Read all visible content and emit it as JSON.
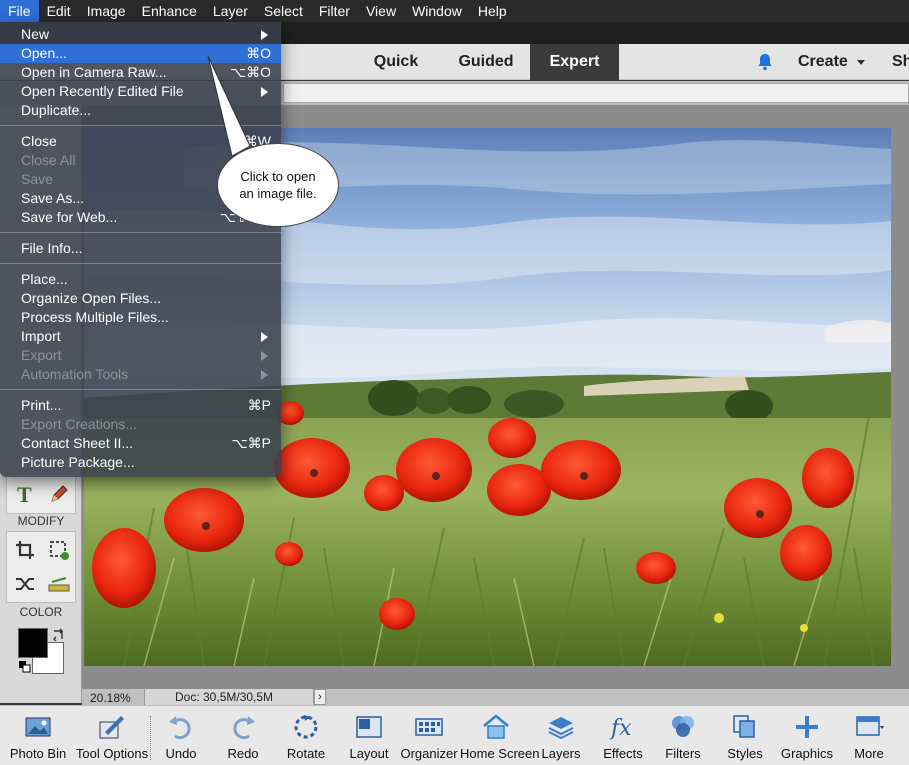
{
  "menubar": {
    "items": [
      "File",
      "Edit",
      "Image",
      "Enhance",
      "Layer",
      "Select",
      "Filter",
      "View",
      "Window",
      "Help"
    ],
    "active_index": 0
  },
  "modes": {
    "quick": "Quick",
    "guided": "Guided",
    "expert": "Expert",
    "create": "Create",
    "share": "Share"
  },
  "file_menu": {
    "groups": [
      [
        {
          "label": "New",
          "shortcut": "",
          "submenu": true,
          "disabled": false
        },
        {
          "label": "Open...",
          "shortcut": "⌘O",
          "submenu": false,
          "disabled": false,
          "selected": true
        },
        {
          "label": "Open in Camera Raw...",
          "shortcut": "⌥⌘O",
          "submenu": false,
          "disabled": false
        },
        {
          "label": "Open Recently Edited File",
          "shortcut": "",
          "submenu": true,
          "disabled": false
        },
        {
          "label": "Duplicate...",
          "shortcut": "",
          "submenu": false,
          "disabled": false
        }
      ],
      [
        {
          "label": "Close",
          "shortcut": "⌘W",
          "submenu": false,
          "disabled": false
        },
        {
          "label": "Close All",
          "shortcut": "",
          "submenu": false,
          "disabled": true
        },
        {
          "label": "Save",
          "shortcut": "",
          "submenu": false,
          "disabled": true
        },
        {
          "label": "Save As...",
          "shortcut": "",
          "submenu": false,
          "disabled": false
        },
        {
          "label": "Save for Web...",
          "shortcut": "⌥⇧⌘S",
          "submenu": false,
          "disabled": false
        }
      ],
      [
        {
          "label": "File Info...",
          "shortcut": "",
          "submenu": false,
          "disabled": false
        }
      ],
      [
        {
          "label": "Place...",
          "shortcut": "",
          "submenu": false,
          "disabled": false
        },
        {
          "label": "Organize Open Files...",
          "shortcut": "",
          "submenu": false,
          "disabled": false
        },
        {
          "label": "Process Multiple Files...",
          "shortcut": "",
          "submenu": false,
          "disabled": false
        },
        {
          "label": "Import",
          "shortcut": "",
          "submenu": true,
          "disabled": false
        },
        {
          "label": "Export",
          "shortcut": "",
          "submenu": true,
          "disabled": true
        },
        {
          "label": "Automation Tools",
          "shortcut": "",
          "submenu": true,
          "disabled": true
        }
      ],
      [
        {
          "label": "Print...",
          "shortcut": "⌘P",
          "submenu": false,
          "disabled": false
        },
        {
          "label": "Export Creations...",
          "shortcut": "",
          "submenu": false,
          "disabled": true
        },
        {
          "label": "Contact Sheet II...",
          "shortcut": "⌥⌘P",
          "submenu": false,
          "disabled": false
        },
        {
          "label": "Picture Package...",
          "shortcut": "",
          "submenu": false,
          "disabled": false
        }
      ]
    ]
  },
  "callout": {
    "text": "Click to open an image file."
  },
  "toolbox": {
    "modify_label": "MODIFY",
    "color_label": "COLOR"
  },
  "status": {
    "zoom": "20.18%",
    "doc": "Doc: 30,5M/30,5M",
    "arrow": "›"
  },
  "taskbar": {
    "items": [
      {
        "label": "Photo Bin",
        "icon": "photo-bin-icon"
      },
      {
        "label": "Tool Options",
        "icon": "tool-options-icon"
      },
      {
        "label": "Undo",
        "icon": "undo-icon"
      },
      {
        "label": "Redo",
        "icon": "redo-icon"
      },
      {
        "label": "Rotate",
        "icon": "rotate-icon"
      },
      {
        "label": "Layout",
        "icon": "layout-icon"
      },
      {
        "label": "Organizer",
        "icon": "organizer-icon"
      },
      {
        "label": "Home Screen",
        "icon": "home-icon"
      },
      {
        "label": "Layers",
        "icon": "layers-icon"
      },
      {
        "label": "Effects",
        "icon": "effects-icon"
      },
      {
        "label": "Filters",
        "icon": "filters-icon"
      },
      {
        "label": "Styles",
        "icon": "styles-icon"
      },
      {
        "label": "Graphics",
        "icon": "graphics-icon"
      },
      {
        "label": "More",
        "icon": "more-icon"
      }
    ]
  },
  "colors": {
    "menu_highlight": "#2f6fd6",
    "foreground_swatch": "#000000",
    "background_swatch": "#ffffff",
    "accent_blue": "#1a73e8"
  }
}
